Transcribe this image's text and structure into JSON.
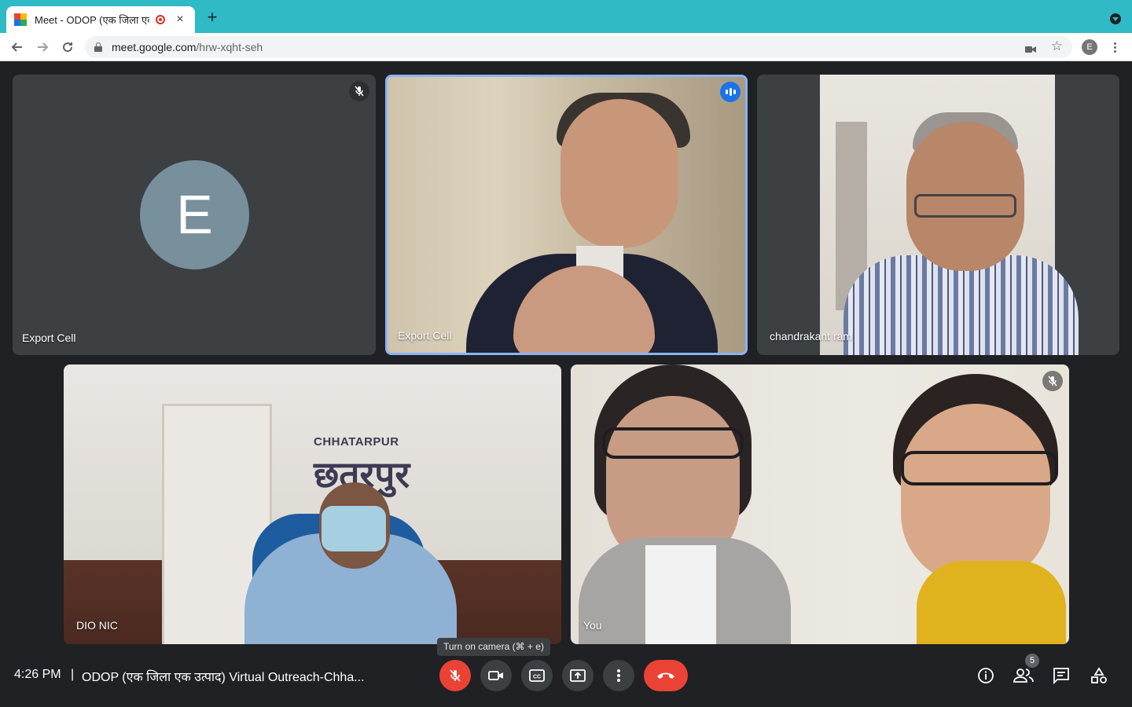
{
  "browser": {
    "tab_title": "Meet - ODOP (एक जिला एक",
    "tab_close": "×",
    "new_tab": "+",
    "url_host": "meet.google.com",
    "url_path": "/hrw-xqht-seh",
    "profile_initial": "E",
    "colors": {
      "tabstrip": "#2fbac6",
      "recording": "#d93025"
    }
  },
  "tiles": [
    {
      "name": "Export Cell",
      "avatar_letter": "E",
      "muted": true
    },
    {
      "name": "Export Cell",
      "speaking": true
    },
    {
      "name": "chandrakant ram"
    },
    {
      "name": "DIO NIC",
      "wall_text": "CHHATARPUR",
      "wall_text_deva": "छतरपुर"
    },
    {
      "name": "You",
      "muted": true
    }
  ],
  "tooltip": "Turn on camera (⌘ + e)",
  "meeting": {
    "time": "4:26 PM",
    "separator": "|",
    "title": "ODOP (एक जिला एक उत्पाद) Virtual Outreach-Chha..."
  },
  "controls": [
    {
      "name": "mic-toggle",
      "icon": "mic-off-icon",
      "state": "off"
    },
    {
      "name": "camera-toggle",
      "icon": "camera-icon"
    },
    {
      "name": "captions",
      "icon": "cc-icon"
    },
    {
      "name": "present-now",
      "icon": "present-icon"
    },
    {
      "name": "more-options",
      "icon": "more-vert-icon"
    },
    {
      "name": "leave-call",
      "icon": "hangup-icon"
    }
  ],
  "people_count": "5",
  "accent_colors": {
    "active_border": "#8ab4f8",
    "speaking_badge": "#1a73e8",
    "danger": "#ea4335"
  }
}
